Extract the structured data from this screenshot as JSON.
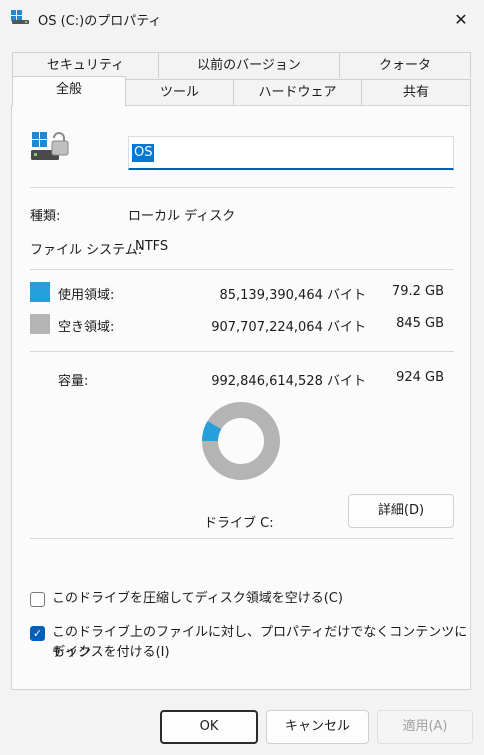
{
  "window": {
    "title": "OS (C:)のプロパティ"
  },
  "tabs_top": [
    "セキュリティ",
    "以前のバージョン",
    "クォータ"
  ],
  "tabs_bottom": [
    "全般",
    "ツール",
    "ハードウェア",
    "共有"
  ],
  "general": {
    "volume_name": "OS",
    "type_label": "種類:",
    "type_value": "ローカル ディスク",
    "fs_label": "ファイル システム:",
    "fs_value": "NTFS",
    "used_label": "使用領域:",
    "used_bytes": "85,139,390,464 バイト",
    "used_gb": "79.2 GB",
    "free_label": "空き領域:",
    "free_bytes": "907,707,224,064 バイト",
    "free_gb": "845 GB",
    "capacity_label": "容量:",
    "capacity_bytes": "992,846,614,528 バイト",
    "capacity_gb": "924 GB",
    "drive_label": "ドライブ C:",
    "details_button": "詳細(D)",
    "used_fraction": 0.0858,
    "compress_label": "このドライブを圧縮してディスク領域を空ける(C)",
    "compress_checked": false,
    "index_label_line1": "このドライブ上のファイルに対し、プロパティだけでなくコンテンツにもイン",
    "index_label_line2": "デックスを付ける(I)",
    "index_checked": true
  },
  "buttons": {
    "ok": "OK",
    "cancel": "キャンセル",
    "apply": "適用(A)"
  },
  "colors": {
    "used": "#26a0da",
    "free": "#b4b4b4",
    "accent": "#005fb8"
  },
  "icons": {
    "close": "close-icon",
    "app": "drive-properties-icon",
    "drive": "hard-drive-icon"
  }
}
